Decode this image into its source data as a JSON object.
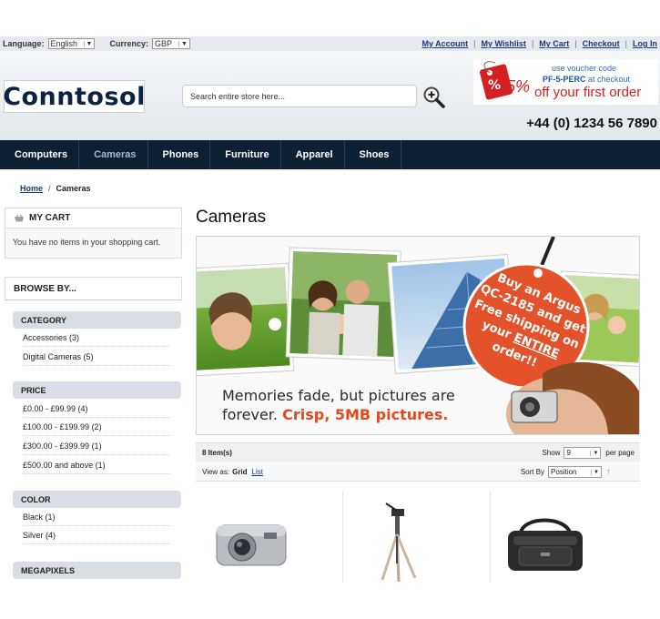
{
  "topbar": {
    "language_label": "Language:",
    "language_value": "English",
    "currency_label": "Currency:",
    "currency_value": "GBP",
    "links": [
      "My Account",
      "My Wishlist",
      "My Cart",
      "Checkout",
      "Log In"
    ]
  },
  "header": {
    "logo": "Conntosol",
    "search_placeholder": "Search entire store here...",
    "voucher": {
      "line1": "use voucher code",
      "code": "PF-5-PERC",
      "line2_suffix": " at checkout",
      "percent": "5%",
      "line3": "off your first order"
    },
    "phone": "+44 (0) 1234 56 7890"
  },
  "nav": {
    "items": [
      "Computers",
      "Cameras",
      "Phones",
      "Furniture",
      "Apparel",
      "Shoes"
    ],
    "active": "Cameras"
  },
  "breadcrumb": {
    "home": "Home",
    "separator": "/",
    "current": "Cameras"
  },
  "sidebar": {
    "cart_title": "MY CART",
    "cart_empty": "You have no items in your shopping cart.",
    "browse_title": "BROWSE BY...",
    "category_title": "CATEGORY",
    "categories": [
      "Accessories (3)",
      "Digital Cameras (5)"
    ],
    "price_title": "PRICE",
    "prices": [
      "£0.00 - £99.99 (4)",
      "£100.00 - £199.99 (2)",
      "£300.00 - £399.99 (1)",
      "£500.00 and above (1)"
    ],
    "color_title": "COLOR",
    "colors": [
      "Black (1)",
      "Silver (4)"
    ],
    "megapixels_title": "MEGAPIXELS"
  },
  "main": {
    "title": "Cameras",
    "banner": {
      "tag_line1": "Buy an Argus",
      "tag_line2": "QC-2185 and get",
      "tag_line3": "Free shipping on",
      "tag_line4_pre": "your ",
      "tag_line4_em": "ENTIRE",
      "tag_line5": "order!!",
      "caption_line1": "Memories fade, but pictures are",
      "caption_line2_pre": "forever. ",
      "caption_line2_accent": "Crisp, 5MB pictures."
    },
    "toolbar": {
      "item_count": "8 Item(s)",
      "show_label": "Show",
      "show_value": "9",
      "per_page": "per page",
      "view_as": "View as:",
      "grid": "Grid",
      "list": "List",
      "sort_by": "Sort By",
      "sort_value": "Position"
    }
  },
  "colors": {
    "nav_bg": "#0c1f33",
    "link": "#1a3a7a",
    "accent_red": "#d42020",
    "voucher_blue": "#2c6fb5"
  }
}
